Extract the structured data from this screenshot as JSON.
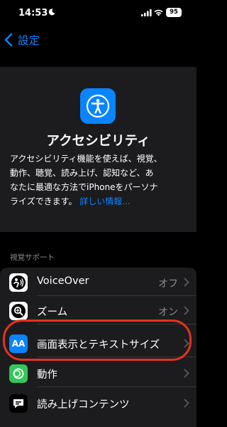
{
  "status": {
    "time": "14:53",
    "battery": "95"
  },
  "nav": {
    "back_label": "設定"
  },
  "header": {
    "title": "アクセシビリティ",
    "desc_lines": [
      "アクセシビリティ機能を使えば、視覚、",
      "動作、聴覚、読み上げ、認知など、あ",
      "なたに最適な方法でiPhoneをパーソナ",
      "ライズできます。"
    ],
    "link": "詳しい情報..."
  },
  "section": {
    "title": "視覚サポート"
  },
  "rows": [
    {
      "label": "VoiceOver",
      "value": "オフ"
    },
    {
      "label": "ズーム",
      "value": "オン"
    },
    {
      "label": "画面表示とテキストサイズ",
      "value": "",
      "icon_text": "AA"
    },
    {
      "label": "動作",
      "value": ""
    },
    {
      "label": "読み上げコンテンツ",
      "value": ""
    }
  ],
  "colors": {
    "accent": "#0a84ff",
    "highlight": "#e5321f",
    "motion_icon": "#34c759"
  }
}
